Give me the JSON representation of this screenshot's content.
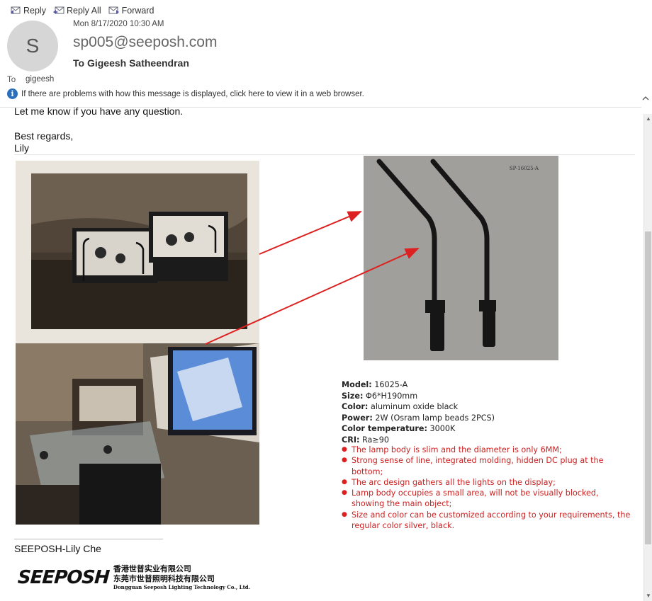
{
  "toolbar": {
    "reply": "Reply",
    "reply_all": "Reply All",
    "forward": "Forward"
  },
  "header": {
    "avatar_letter": "S",
    "date": "Mon 8/17/2020 10:30 AM",
    "from": "sp005@seeposh.com",
    "to_full": "To Gigeesh Satheendran",
    "to_label": "To",
    "to_name": "gigeesh",
    "info": "If there are problems with how this message is displayed, click here to view it in a web browser."
  },
  "body": {
    "cut_line": "Let me know if you have any question.",
    "greeting": "Best regards,",
    "sign_name": "Lily",
    "product_stamp": "SP-16025-A",
    "specs": [
      {
        "label": "Model:",
        "value": " 16025-A"
      },
      {
        "label": "Size:",
        "value": " Φ6*H190mm"
      },
      {
        "label": "Color:",
        "value": " aluminum oxide black"
      },
      {
        "label": "Power:",
        "value": " 2W (Osram lamp beads 2PCS)"
      },
      {
        "label": "Color temperature:",
        "value": " 3000K"
      },
      {
        "label": "CRI:",
        "value": " Ra≥90"
      }
    ],
    "bullets": [
      "The lamp body is slim and the diameter is only 6MM;",
      "Strong sense of line, integrated molding, hidden DC plug at the bottom;",
      "The arc design gathers all the lights on the display;",
      "Lamp body occupies a small area, will not be visually blocked, showing the main object;",
      "Size and color can be customized according to your requirements, the regular color silver, black."
    ],
    "signature": "SEEPOSH-Lily Che",
    "logo": {
      "word": "SEEPOSH",
      "cn_line1": "香港世普实业有限公司",
      "cn_line2": "东莞市世普照明科技有限公司",
      "en_line": "Dongguan Seeposh Lighting Technology Co., Ltd."
    }
  },
  "colors": {
    "accent_red": "#cc2020",
    "info_blue": "#2a6ebb"
  }
}
